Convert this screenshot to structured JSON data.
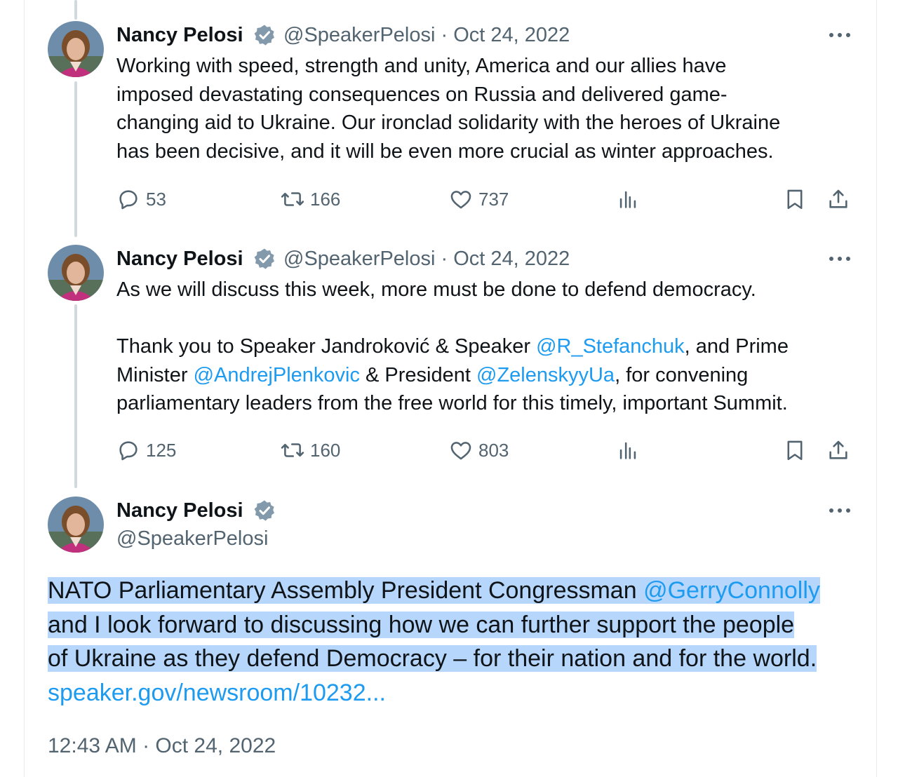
{
  "tweets": [
    {
      "name": "Nancy Pelosi",
      "handle_line": "@SpeakerPelosi · Oct 24, 2022",
      "lines": [
        "Working with speed, strength and unity, America and our allies have",
        "imposed devastating consequences on Russia and delivered game-",
        "changing aid to Ukraine. Our ironclad solidarity with the heroes of Ukraine",
        "has been decisive, and it will be even more crucial as winter approaches."
      ],
      "replies": "53",
      "retweets": "166",
      "likes": "737"
    },
    {
      "name": "Nancy Pelosi",
      "handle_line": "@SpeakerPelosi · Oct 24, 2022",
      "line1": "As we will discuss this week, more must be done to defend democracy.",
      "line2_a": "Thank you to Speaker Jandroković & Speaker ",
      "line2_mention": "@R_Stefanchuk",
      "line2_b": ", and Prime",
      "line3_a": "Minister ",
      "line3_mention1": "@AndrejPlenkovic",
      "line3_b": " & President ",
      "line3_mention2": "@ZelenskyyUa",
      "line3_c": ", for convening",
      "line4": "parliamentary leaders from the free world for this timely, important Summit.",
      "replies": "125",
      "retweets": "160",
      "likes": "803"
    }
  ],
  "main_tweet": {
    "name": "Nancy Pelosi",
    "handle": "@SpeakerPelosi",
    "line1_a": "NATO Parliamentary Assembly President Congressman ",
    "line1_mention": "@GerryConnolly",
    "line2": "and I look forward to discussing how we can further support the people",
    "line3": "of Ukraine as they defend Democracy – for their nation and for the world.",
    "link": "speaker.gov/newsroom/10232...",
    "timestamp": "12:43 AM · Oct 24, 2022"
  },
  "colors": {
    "accent": "#1d9bf0",
    "secondary_text": "#536471",
    "highlight": "#b7d6fb",
    "verified_badge": "#829aab"
  },
  "icons": [
    "reply-icon",
    "retweet-icon",
    "like-icon",
    "views-icon",
    "bookmark-icon",
    "share-icon",
    "more-icon",
    "verified-icon"
  ]
}
